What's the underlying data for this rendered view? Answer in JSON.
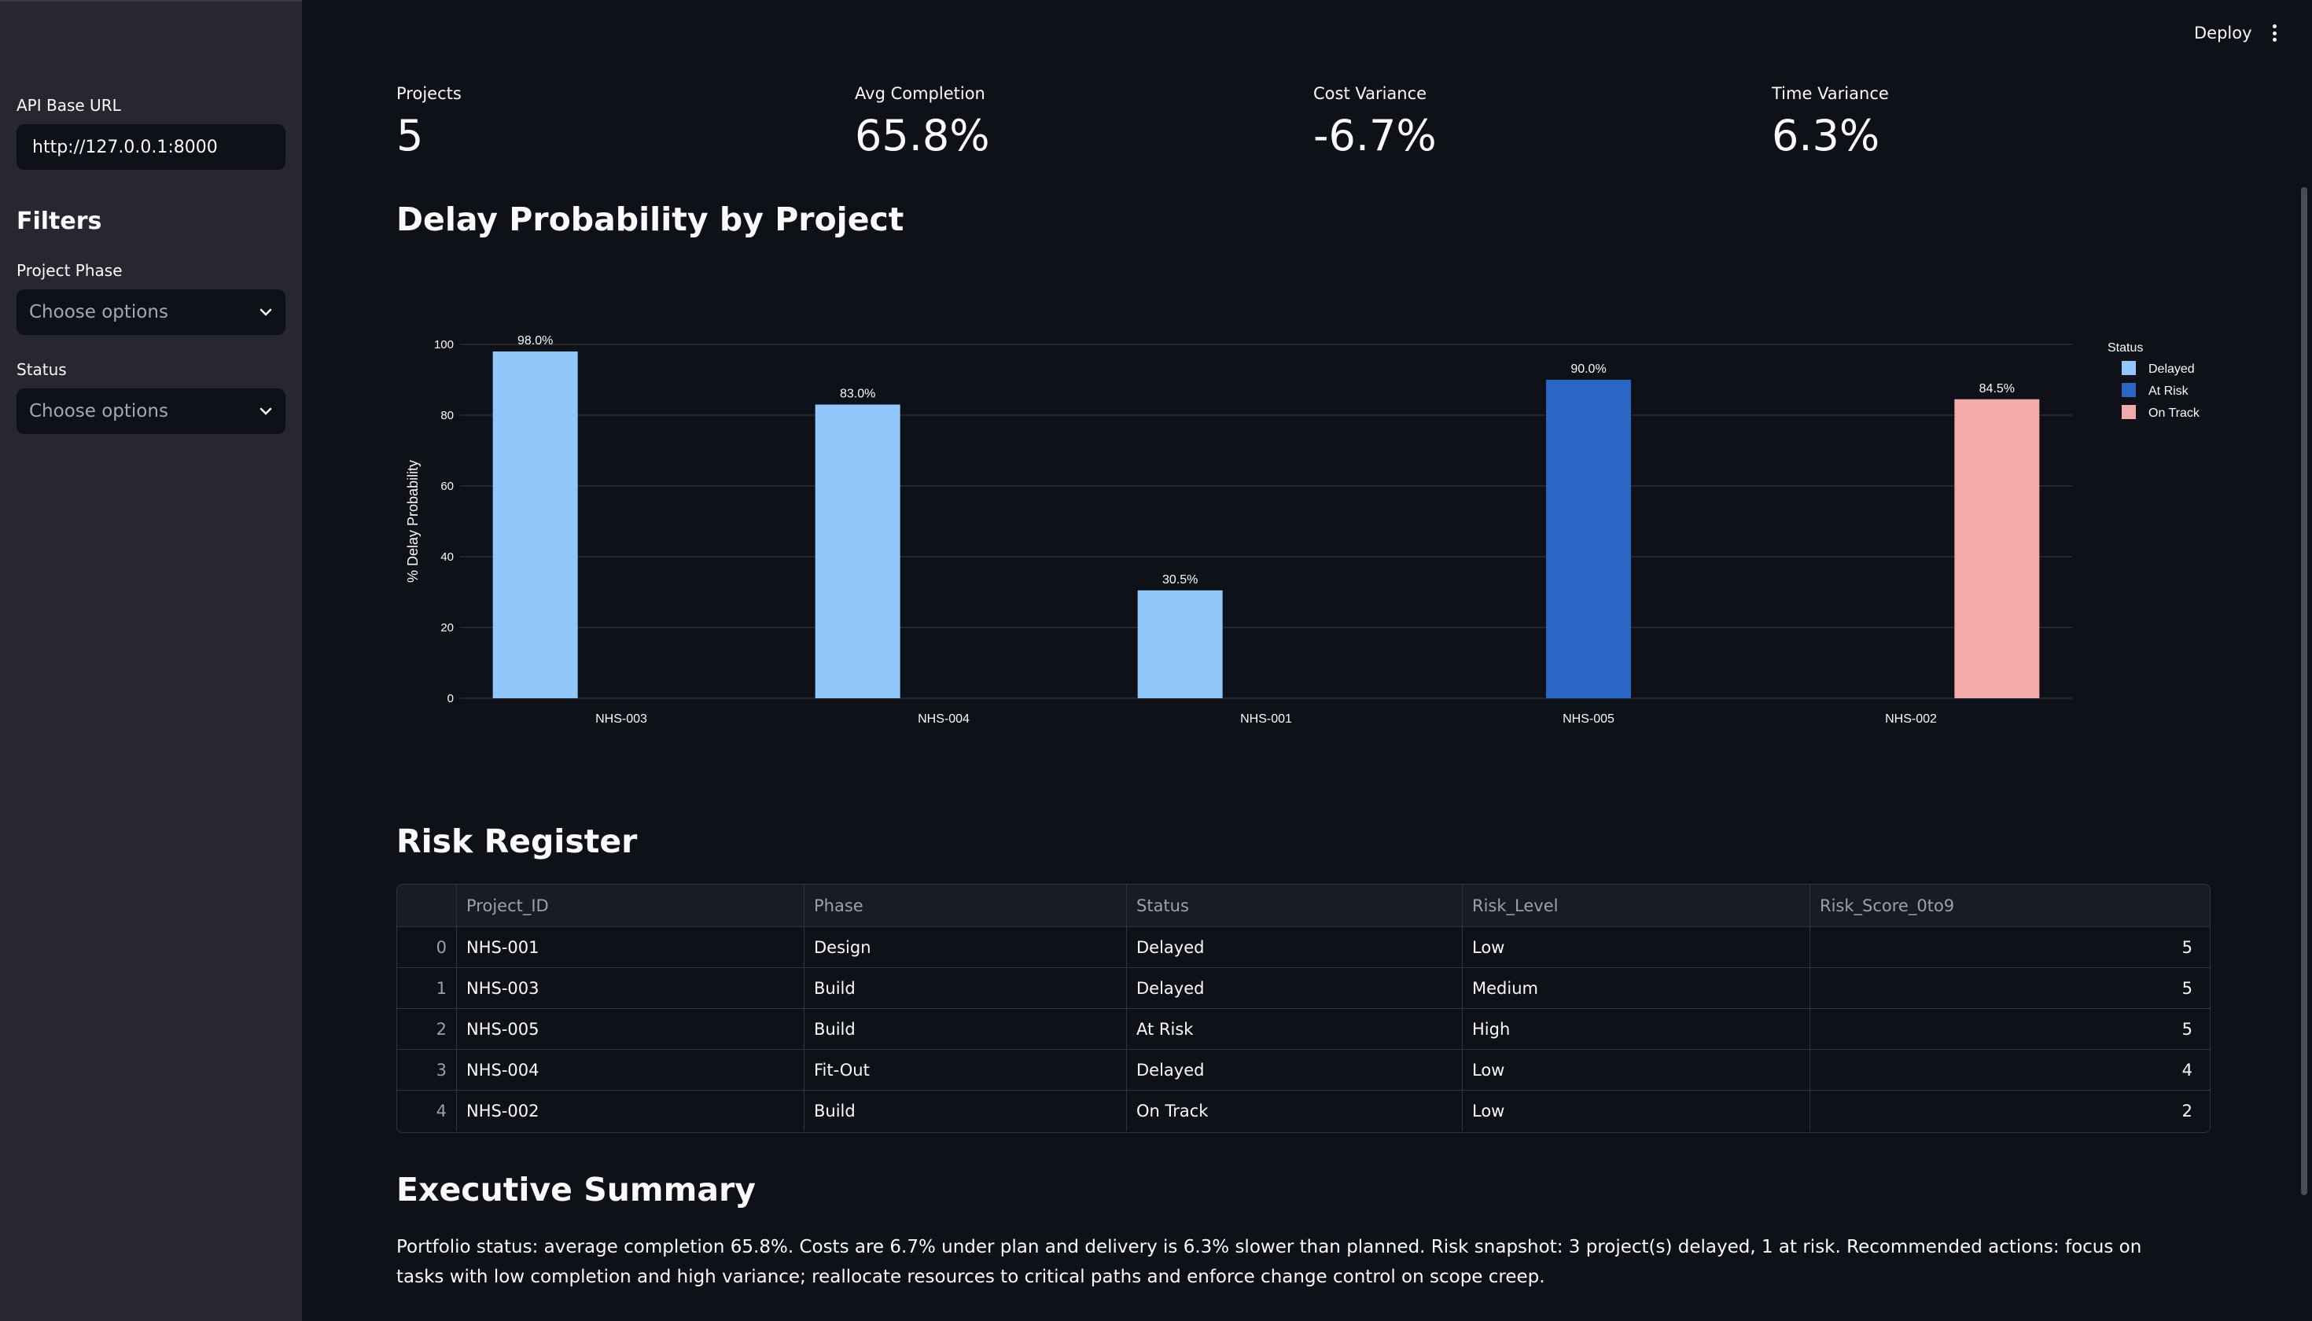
{
  "topbar": {
    "deploy_label": "Deploy",
    "menu_icon": "kebab-menu-icon"
  },
  "sidebar": {
    "api_label": "API Base URL",
    "api_value": "http://127.0.0.1:8000",
    "filters_title": "Filters",
    "phase_label": "Project Phase",
    "phase_placeholder": "Choose options",
    "status_label": "Status",
    "status_placeholder": "Choose options"
  },
  "metrics": [
    {
      "label": "Projects",
      "value": "5"
    },
    {
      "label": "Avg Completion",
      "value": "65.8%"
    },
    {
      "label": "Cost Variance",
      "value": "-6.7%"
    },
    {
      "label": "Time Variance",
      "value": "6.3%"
    }
  ],
  "chart_heading": "Delay Probability by Project",
  "chart_data": {
    "type": "bar",
    "categories": [
      "NHS-003",
      "NHS-004",
      "NHS-001",
      "NHS-005",
      "NHS-002"
    ],
    "series": [
      {
        "name": "Delayed",
        "color": "#90c8fb",
        "values": [
          98.0,
          83.0,
          30.5,
          null,
          null
        ]
      },
      {
        "name": "At Risk",
        "color": "#2a66c4",
        "values": [
          null,
          null,
          null,
          90.0,
          null
        ]
      },
      {
        "name": "On Track",
        "color": "#f2aaaa",
        "values": [
          null,
          null,
          null,
          null,
          84.5
        ]
      }
    ],
    "data_labels": [
      "98.0%",
      "83.0%",
      "30.5%",
      "90.0%",
      "84.5%"
    ],
    "ylabel": "% Delay Probability",
    "xlabel": "",
    "ylim": [
      0,
      100
    ],
    "yticks": [
      0,
      20,
      40,
      60,
      80,
      100
    ],
    "legend_title": "Status",
    "legend_position": "right",
    "grid": true
  },
  "risk_heading": "Risk Register",
  "table": {
    "columns": [
      "",
      "Project_ID",
      "Phase",
      "Status",
      "Risk_Level",
      "Risk_Score_0to9"
    ],
    "rows": [
      [
        "0",
        "NHS-001",
        "Design",
        "Delayed",
        "Low",
        "5"
      ],
      [
        "1",
        "NHS-003",
        "Build",
        "Delayed",
        "Medium",
        "5"
      ],
      [
        "2",
        "NHS-005",
        "Build",
        "At Risk",
        "High",
        "5"
      ],
      [
        "3",
        "NHS-004",
        "Fit-Out",
        "Delayed",
        "Low",
        "4"
      ],
      [
        "4",
        "NHS-002",
        "Build",
        "On Track",
        "Low",
        "2"
      ]
    ]
  },
  "summary_heading": "Executive Summary",
  "summary_text": "Portfolio status: average completion 65.8%. Costs are 6.7% under plan and delivery is 6.3% slower than planned. Risk snapshot: 3 project(s) delayed, 1 at risk. Recommended actions: focus on tasks with low completion and high variance; reallocate resources to critical paths and enforce change control on scope creep."
}
